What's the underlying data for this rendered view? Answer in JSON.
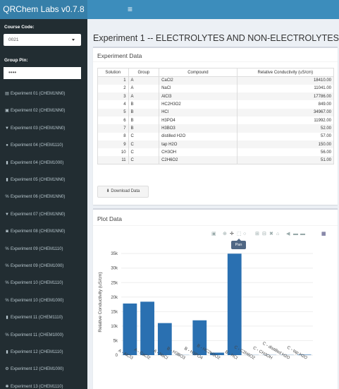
{
  "app": {
    "title": "QRChem Labs v0.7.8",
    "menu_icon": "hamburger-icon"
  },
  "sidebar": {
    "course_label": "Course Code:",
    "course_value": "0021",
    "pin_label": "Group Pin:",
    "pin_value": "••••",
    "items": [
      {
        "label": "Experiment 01 (CHEM1NN0)",
        "icon": "calculator-icon",
        "glyph": "▤"
      },
      {
        "label": "Experiment 02 (CHEM1NN0)",
        "icon": "cube-icon",
        "glyph": "▣"
      },
      {
        "label": "Experiment 03 (CHEM1NN0)",
        "icon": "filter-icon",
        "glyph": "▼"
      },
      {
        "label": "Experiment 04 (CHEM1110)",
        "icon": "tint-icon",
        "glyph": "●"
      },
      {
        "label": "Experiment 04 (CHEM1000)",
        "icon": "flask-icon",
        "glyph": "▮"
      },
      {
        "label": "Experiment 05 (CHEM1NN0)",
        "icon": "flask-icon",
        "glyph": "▮"
      },
      {
        "label": "Experiment 06 (CHEM1NN0)",
        "icon": "percent-icon",
        "glyph": "%"
      },
      {
        "label": "Experiment 07 (CHEM1NN0)",
        "icon": "filter-icon",
        "glyph": "▼"
      },
      {
        "label": "Experiment 08 (CHEM1NN0)",
        "icon": "fire-icon",
        "glyph": "◙"
      },
      {
        "label": "Experiment 09 (CHEM1110)",
        "icon": "percent-icon",
        "glyph": "%"
      },
      {
        "label": "Experiment 09 (CHEM1000)",
        "icon": "percent-icon",
        "glyph": "%"
      },
      {
        "label": "Experiment 10 (CHEM1110)",
        "icon": "percent-icon",
        "glyph": "%"
      },
      {
        "label": "Experiment 10 (CHEM1000)",
        "icon": "percent-icon",
        "glyph": "%"
      },
      {
        "label": "Experiment 11 (CHEM1110)",
        "icon": "flask-icon",
        "glyph": "▮"
      },
      {
        "label": "Experiment 11 (CHEM1000)",
        "icon": "percent-icon",
        "glyph": "%"
      },
      {
        "label": "Experiment 12 (CHEM1110)",
        "icon": "flask-icon",
        "glyph": "▮"
      },
      {
        "label": "Experiment 12 (CHEM1000)",
        "icon": "gear-icon",
        "glyph": "⚙"
      },
      {
        "label": "Experiment 13 (CHEM1110)",
        "icon": "asterisk-icon",
        "glyph": "✱"
      }
    ]
  },
  "main": {
    "page_title": "Experiment 1 -- ELECTROLYTES AND NON-ELECTROLYTES",
    "data_box_title": "Experiment Data",
    "plot_box_title": "Plot Data",
    "download_label": "Download Data",
    "tooltip": "Pan",
    "table": {
      "headers": [
        "Solution",
        "Group",
        "Compound",
        "Relative Conductivity (uS/cm)"
      ],
      "rows": [
        [
          "1",
          "A",
          "CaCl2",
          "18410.00"
        ],
        [
          "2",
          "A",
          "NaCl",
          "11041.00"
        ],
        [
          "3",
          "A",
          "AlCl3",
          "17786.00"
        ],
        [
          "4",
          "B",
          "HC2H3O2",
          "849.00"
        ],
        [
          "5",
          "B",
          "HCl",
          "34967.00"
        ],
        [
          "6",
          "B",
          "H3PO4",
          "11992.00"
        ],
        [
          "7",
          "B",
          "H3BO3",
          "52.00"
        ],
        [
          "8",
          "C",
          "distilled H2O",
          "57.00"
        ],
        [
          "9",
          "C",
          "tap H2O",
          "150.00"
        ],
        [
          "10",
          "C",
          "CH3OH",
          "56.00"
        ],
        [
          "11",
          "C",
          "C2H6O2",
          "51.00"
        ]
      ]
    }
  },
  "chart_data": {
    "type": "bar",
    "ylabel": "Relative Conductivity (uS/cm)",
    "ylim": [
      0,
      36500
    ],
    "yticks": [
      0,
      5000,
      10000,
      15000,
      20000,
      25000,
      30000,
      35000
    ],
    "ytick_labels": [
      "0",
      "5k",
      "10k",
      "15k",
      "20k",
      "25k",
      "30k",
      "35k"
    ],
    "categories": [
      "A - AlCl3",
      "A - CaCl2",
      "A - NaCl",
      "B - H3BO3",
      "B - H3PO4",
      "B - HC2H3O2",
      "B - HCl",
      "C - C2H6O2",
      "C - CH3OH",
      "C - distilled H2O",
      "C - tap H2O"
    ],
    "values": [
      17786,
      18410,
      11041,
      52,
      11992,
      849,
      34967,
      51,
      56,
      57,
      150
    ],
    "bar_color": "#2a70b1",
    "grid": true
  }
}
